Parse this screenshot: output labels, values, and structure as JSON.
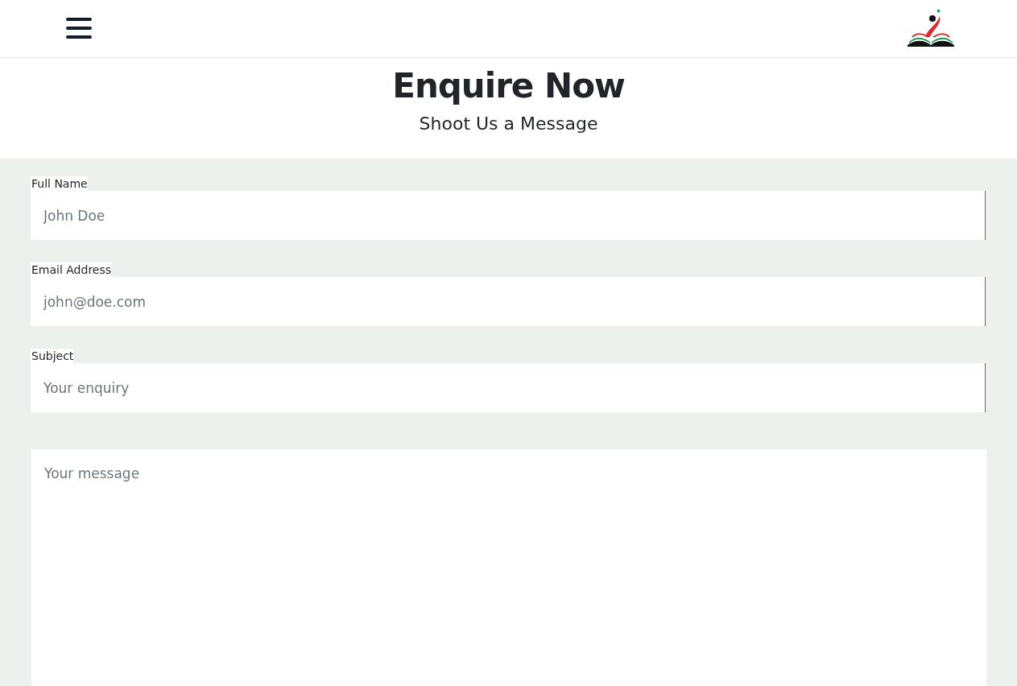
{
  "heading": {
    "title": "Enquire Now",
    "subtitle": "Shoot Us a Message"
  },
  "form": {
    "fields": [
      {
        "kind": "input",
        "label": "Full Name",
        "placeholder": "John Doe"
      },
      {
        "kind": "input",
        "label": "Email Address",
        "placeholder": "john@doe.com"
      },
      {
        "kind": "input",
        "label": "Subject",
        "placeholder": "Your enquiry"
      },
      {
        "kind": "textarea",
        "placeholder": "Your message"
      }
    ]
  }
}
